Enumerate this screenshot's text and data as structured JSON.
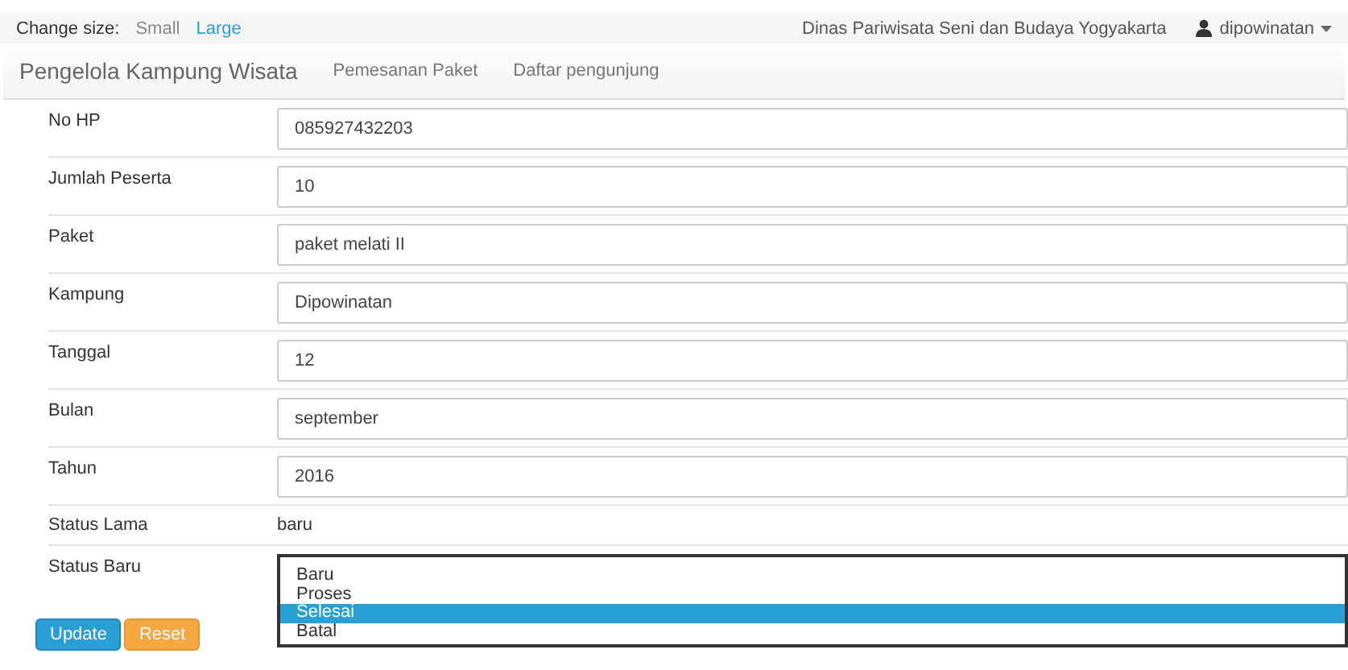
{
  "top_bar": {
    "label": "Change size:",
    "sizes": [
      {
        "label": "Small",
        "selected": false
      },
      {
        "label": "Large",
        "selected": true
      }
    ],
    "organization": "Dinas Pariwisata Seni dan Budaya Yogyakarta",
    "user": "dipowinatan"
  },
  "navbar": {
    "brand": "Pengelola Kampung Wisata",
    "links": [
      "Pemesanan Paket",
      "Daftar pengunjung"
    ]
  },
  "form": {
    "fields": [
      {
        "kind": "input",
        "label": "No HP",
        "value": "085927432203"
      },
      {
        "kind": "input",
        "label": "Jumlah Peserta",
        "value": "10"
      },
      {
        "kind": "input",
        "label": "Paket",
        "value": "paket melati II"
      },
      {
        "kind": "input",
        "label": "Kampung",
        "value": "Dipowinatan"
      },
      {
        "kind": "input",
        "label": "Tanggal",
        "value": "12"
      },
      {
        "kind": "input",
        "label": "Bulan",
        "value": "september"
      },
      {
        "kind": "input",
        "label": "Tahun",
        "value": "2016"
      },
      {
        "kind": "text",
        "label": "Status Lama",
        "value": "baru"
      },
      {
        "kind": "listbox",
        "label": "Status Baru",
        "options": [
          {
            "label": "Baru",
            "selected": false
          },
          {
            "label": "Proses",
            "selected": false
          },
          {
            "label": "Selesai",
            "selected": true
          },
          {
            "label": "Batal",
            "selected": false
          }
        ]
      }
    ],
    "buttons": [
      {
        "label": "Update",
        "kind": "primary"
      },
      {
        "label": "Reset",
        "kind": "warning"
      }
    ]
  }
}
